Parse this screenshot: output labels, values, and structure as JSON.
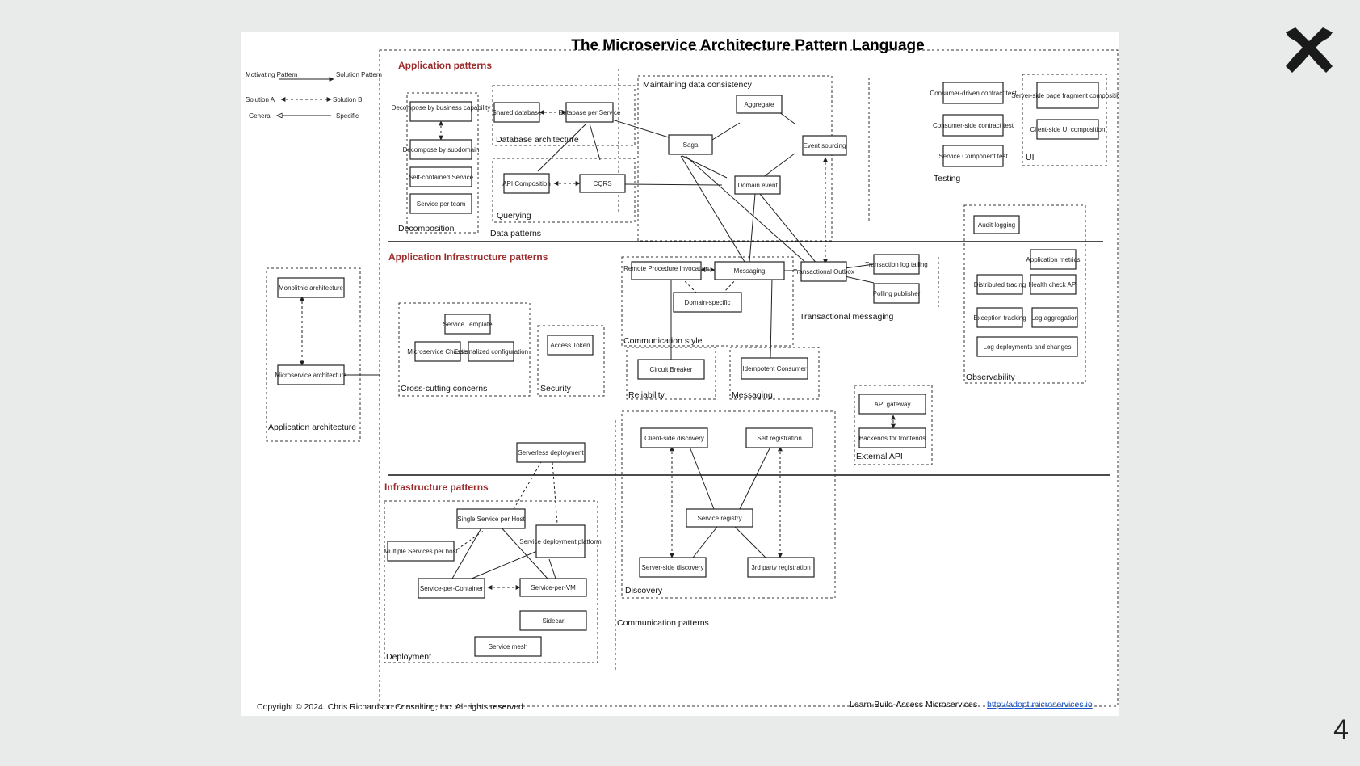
{
  "title": "The Microservice Architecture Pattern Language",
  "legend": [
    {
      "left": "Motivating Pattern",
      "right": "Solution Pattern"
    },
    {
      "left": "Solution A",
      "right": "Solution B"
    },
    {
      "left": "General",
      "right": "Specific"
    }
  ],
  "sections": {
    "application": "Application patterns",
    "app_infra": "Application Infrastructure patterns",
    "infra": "Infrastructure patterns"
  },
  "groups": {
    "decomposition": "Decomposition",
    "database_arch": "Database architecture",
    "querying": "Querying",
    "data_patterns": "Data patterns",
    "consistency": "Maintaining data consistency",
    "testing": "Testing",
    "ui": "UI",
    "observability": "Observability",
    "app_arch": "Application architecture",
    "cross_cutting": "Cross-cutting concerns",
    "security": "Security",
    "comm_style": "Communication style",
    "transactional_messaging": "Transactional messaging",
    "reliability": "Reliability",
    "messaging": "Messaging",
    "external_api": "External API",
    "discovery": "Discovery",
    "comm_patterns": "Communication patterns",
    "deployment": "Deployment"
  },
  "patterns": {
    "decompose_cap": "Decompose by business capability",
    "decompose_sub": "Decompose by subdomain",
    "self_contained": "Self-contained Service",
    "service_team": "Service per team",
    "shared_db": "Shared database",
    "db_per_service": "Database per Service",
    "api_comp": "API Composition",
    "cqrs": "CQRS",
    "saga": "Saga",
    "aggregate": "Aggregate",
    "event_sourcing": "Event sourcing",
    "domain_event": "Domain event",
    "consumer_contract": "Consumer-driven contract test",
    "consumer_side": "Consumer-side contract test",
    "component_test": "Service Component test",
    "server_fragment": "Server-side page fragment composition",
    "client_ui": "Client-side UI composition",
    "audit_logging": "Audit logging",
    "app_metrics": "Application metrics",
    "dist_tracing": "Distributed tracing",
    "health_check": "Health check API",
    "exception_tracking": "Exception tracking",
    "log_aggregation": "Log aggregation",
    "log_deployments": "Log deployments and changes",
    "monolithic": "Monolithic architecture",
    "microservice_arch": "Microservice architecture",
    "service_template": "Service Template",
    "chassis": "Microservice Chassis",
    "ext_config": "Externalized configuration",
    "access_token": "Access Token",
    "rpi": "Remote Procedure Invocation",
    "messaging": "Messaging",
    "domain_specific": "Domain-specific",
    "outbox": "Transactional Outbox",
    "log_tailing": "Transaction log tailing",
    "polling": "Polling publisher",
    "circuit_breaker": "Circuit Breaker",
    "idempotent": "Idempotent Consumer",
    "api_gateway": "API gateway",
    "bff": "Backends for frontends",
    "client_discovery": "Client-side discovery",
    "self_registration": "Self registration",
    "service_registry": "Service registry",
    "server_discovery": "Server-side discovery",
    "third_party": "3rd party registration",
    "serverless": "Serverless deployment",
    "single_host": "Single Service per Host",
    "multiple_host": "Multiple Services per host",
    "deploy_platform": "Service deployment platform",
    "container": "Service-per-Container",
    "vm": "Service-per-VM",
    "sidecar": "Sidecar",
    "service_mesh": "Service mesh"
  },
  "footer": {
    "copyright": "Copyright © 2024. Chris Richardson Consulting, Inc. All rights reserved.",
    "tagline": "Learn-Build-Assess Microservices",
    "link": "http://adopt.microservices.io"
  },
  "page_number": "4",
  "colors": {
    "section_heading": "#9b2c2c",
    "link": "#1a56c9",
    "background": "#e9ebeb"
  }
}
